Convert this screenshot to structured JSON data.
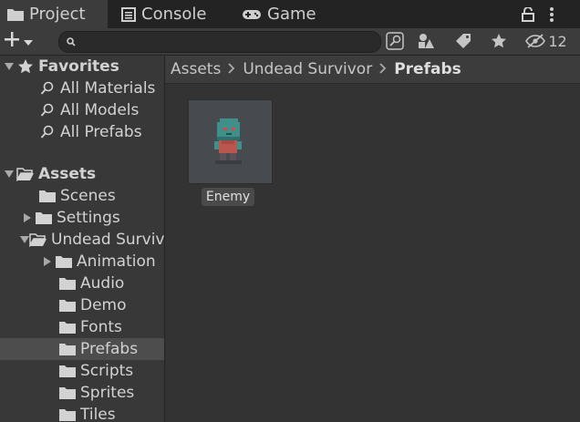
{
  "tabs": [
    {
      "label": "Project",
      "icon": "folder-icon"
    },
    {
      "label": "Console",
      "icon": "console-icon"
    },
    {
      "label": "Game",
      "icon": "gamepad-icon"
    }
  ],
  "toolbar": {
    "search_placeholder": "",
    "hidden_count": "12"
  },
  "tree": {
    "favorites_label": "Favorites",
    "favorites": [
      "All Materials",
      "All Models",
      "All Prefabs"
    ],
    "assets_label": "Assets",
    "assets": [
      "Scenes",
      "Settings",
      "Undead Survivor"
    ],
    "undead": [
      "Animation",
      "Audio",
      "Demo",
      "Fonts",
      "Prefabs",
      "Scripts",
      "Sprites",
      "Tiles"
    ],
    "selected": "Prefabs"
  },
  "breadcrumb": [
    "Assets",
    "Undead Survivor",
    "Prefabs"
  ],
  "asset": {
    "label": "Enemy"
  },
  "colors": {
    "background": "#383838",
    "selected_row": "#4d4d4d",
    "thumbnail_bg": "#474b50"
  }
}
